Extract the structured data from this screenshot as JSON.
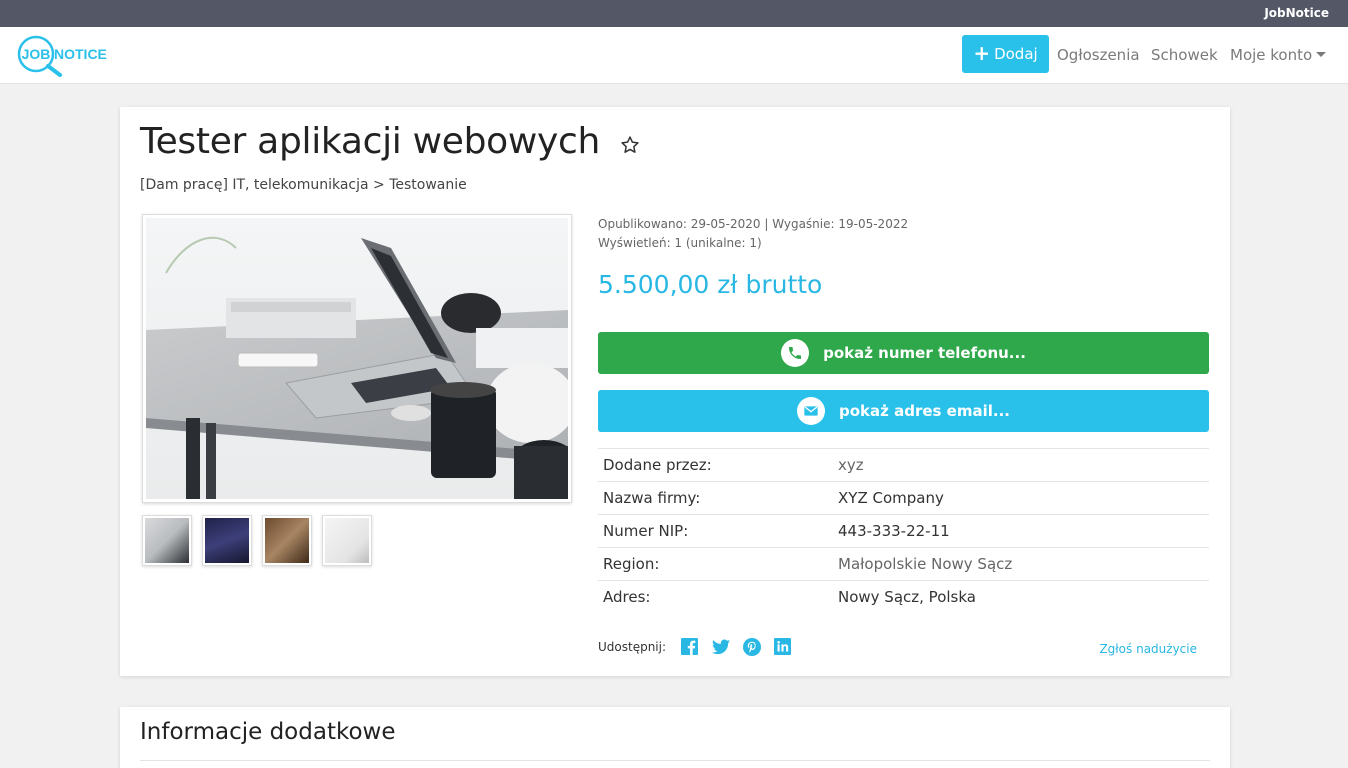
{
  "topbar": {
    "brand": "JobNotice"
  },
  "navbar": {
    "logo_text_left": "JOB",
    "logo_text_right": "NOTICE",
    "add_label": "Dodaj",
    "links": [
      "Ogłoszenia",
      "Schowek",
      "Moje konto"
    ]
  },
  "listing": {
    "title": "Tester aplikacji webowych",
    "breadcrumb": "[Dam pracę] IT, telekomunikacja > Testowanie",
    "published": "Opublikowano: 29-05-2020 | Wygaśnie: 19-05-2022",
    "views": "Wyświetleń: 1 (unikalne: 1)",
    "price": "5.500,00 zł brutto",
    "phone_button": "pokaż numer telefonu...",
    "email_button": "pokaż adres email...",
    "details": [
      {
        "key": "Dodane przez:",
        "value": "xyz"
      },
      {
        "key": "Nazwa firmy:",
        "value": "XYZ Company"
      },
      {
        "key": "Numer NIP:",
        "value": "443-333-22-11"
      },
      {
        "key": "Region:",
        "value": "Małopolskie Nowy Sącz"
      },
      {
        "key": "Adres:",
        "value": "Nowy Sącz, Polska"
      }
    ],
    "share_label": "Udostępnij:",
    "share_icons": [
      "facebook-icon",
      "twitter-icon",
      "pinterest-icon",
      "linkedin-icon"
    ],
    "report_link": "Zgłoś nadużycie"
  },
  "extra": {
    "title": "Informacje dodatkowe"
  },
  "colors": {
    "accent": "#29c0e9",
    "success": "#2ea84a",
    "topbar": "#545766"
  }
}
